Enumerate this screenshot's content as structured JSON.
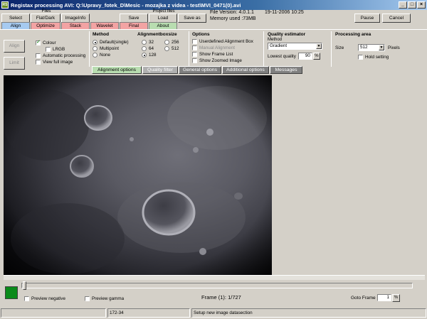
{
  "window": {
    "title": "Registax processing AVI: Q:\\Upravy_fotek_D\\Mesic - mozajka z videa - test\\MVI_0471(0).avi",
    "app_icon": "registax-icon"
  },
  "toolbar": {
    "files_label": "Files",
    "project_label": "Project files",
    "select": "Select",
    "flatdark": "Flat/Dark",
    "imageinfo": "ImageInfo",
    "save": "Save",
    "load": "Load",
    "save_as": "Save as",
    "pause": "Pause",
    "cancel": "Cancel"
  },
  "info": {
    "version": "File Version: 4.0.1.1",
    "date": "19-11-2006 10:25",
    "memory": "Memory used :73MB"
  },
  "tabs": [
    {
      "label": "Align",
      "color": "#a6caf0"
    },
    {
      "label": "Optimize",
      "color": "#f2a3a3"
    },
    {
      "label": "Stack",
      "color": "#f2a3a3"
    },
    {
      "label": "Wavelet",
      "color": "#f2a3a3"
    },
    {
      "label": "Final",
      "color": "#f2a3a3"
    },
    {
      "label": "About",
      "color": "#b8ddb0"
    }
  ],
  "panel": {
    "align_btn": "Align",
    "limit_btn": "Limit",
    "colour": "Colour",
    "lrgb": "LRGB",
    "auto_processing": "Automatic processing",
    "view_full": "View full image",
    "method_title": "Method",
    "method_options": [
      "Default(single)",
      "Multipoint",
      "None"
    ],
    "box_title": "Alignmentboxsize",
    "box_options": [
      "32",
      "64",
      "128",
      "256",
      "512"
    ],
    "options_title": "Options",
    "options": [
      "Userdefined Alignment Box",
      "Manual Alignment",
      "Show Frame List",
      "Show Zoomed Image"
    ],
    "quality_title": "Quality estimator",
    "quality_method_label": "Method",
    "quality_method": "Gradient",
    "lowest_quality_label": "Lowest quality",
    "lowest_quality": "90",
    "processing_title": "Processing area",
    "size_label": "Size",
    "size_value": "512",
    "pixels": "Pixels",
    "hold": "Hold setting"
  },
  "subtabs": [
    "Alignment options",
    "Quality filter",
    "General options",
    "Additional options",
    "Messages"
  ],
  "bottom": {
    "preview_negative": "Preview negative",
    "preview_gamma": "Preview gamma",
    "frame": "Frame (1): 1/727",
    "goto_label": "Goto Frame",
    "goto_value": "1",
    "status_code": "172-34",
    "status_msg": "Setup new image datasection"
  }
}
